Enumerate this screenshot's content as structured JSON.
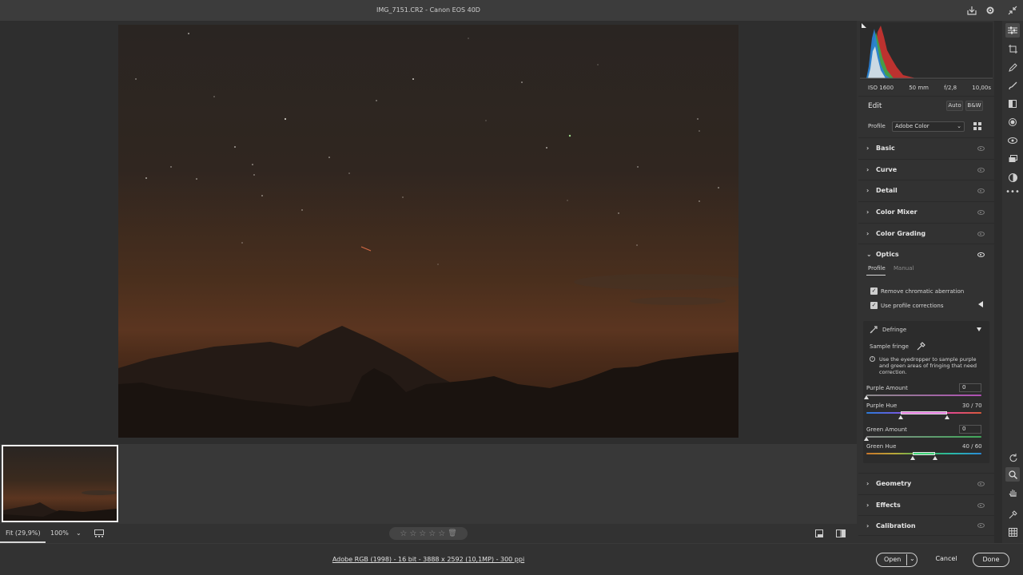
{
  "window": {
    "title": "IMG_7151.CR2  -  Canon EOS 40D"
  },
  "exif": {
    "iso": "ISO 1600",
    "focal": "50 mm",
    "aperture": "f/2,8",
    "shutter": "10,00s"
  },
  "edit": {
    "title": "Edit",
    "auto_label": "Auto",
    "bw_label": "B&W",
    "profile_label": "Profile",
    "profile_value": "Adobe Color"
  },
  "sections": {
    "basic": "Basic",
    "curve": "Curve",
    "detail": "Detail",
    "color_mixer": "Color Mixer",
    "color_grading": "Color Grading",
    "optics": "Optics",
    "geometry": "Geometry",
    "effects": "Effects",
    "calibration": "Calibration"
  },
  "optics": {
    "tabs": [
      "Profile",
      "Manual"
    ],
    "remove_ca": "Remove chromatic aberration",
    "use_profile": "Use profile corrections",
    "defringe": {
      "title": "Defringe",
      "sample_fringe": "Sample fringe",
      "info": "Use the eyedropper to sample purple and green areas of fringing that need correction.",
      "purple_amount_label": "Purple Amount",
      "purple_amount_value": "0",
      "purple_amount": 0,
      "purple_hue_label": "Purple Hue",
      "purple_hue_value": "30 / 70",
      "purple_hue": [
        30,
        70
      ],
      "green_amount_label": "Green Amount",
      "green_amount_value": "0",
      "green_amount": 0,
      "green_hue_label": "Green Hue",
      "green_hue_value": "40 / 60",
      "green_hue": [
        40,
        60
      ]
    }
  },
  "statusbar": {
    "fit": "Fit (29,9%)",
    "zoom": "100%",
    "stars": [
      "☆",
      "☆",
      "☆",
      "☆",
      "☆"
    ]
  },
  "footer": {
    "info": "Adobe RGB (1998) - 16 bit - 3888 x 2592 (10,1MP) - 300 ppi",
    "open": "Open",
    "cancel": "Cancel",
    "done": "Done"
  },
  "colors": {
    "accent": "#1473e6",
    "panel": "#323232",
    "photo_glow": "#5b3520"
  },
  "icons": {
    "titlebar": [
      "save-icon",
      "gear-icon",
      "collapse-icon"
    ],
    "tools": [
      "edit-sliders-icon",
      "crop-icon",
      "healing-icon",
      "brush-icon",
      "linear-gradient-icon",
      "radial-gradient-icon",
      "red-eye-icon",
      "snapshots-icon",
      "presets-icon",
      "more-icon",
      "rotate-icon",
      "zoom-icon",
      "hand-icon",
      "color-sampler-icon",
      "grid-icon"
    ]
  }
}
